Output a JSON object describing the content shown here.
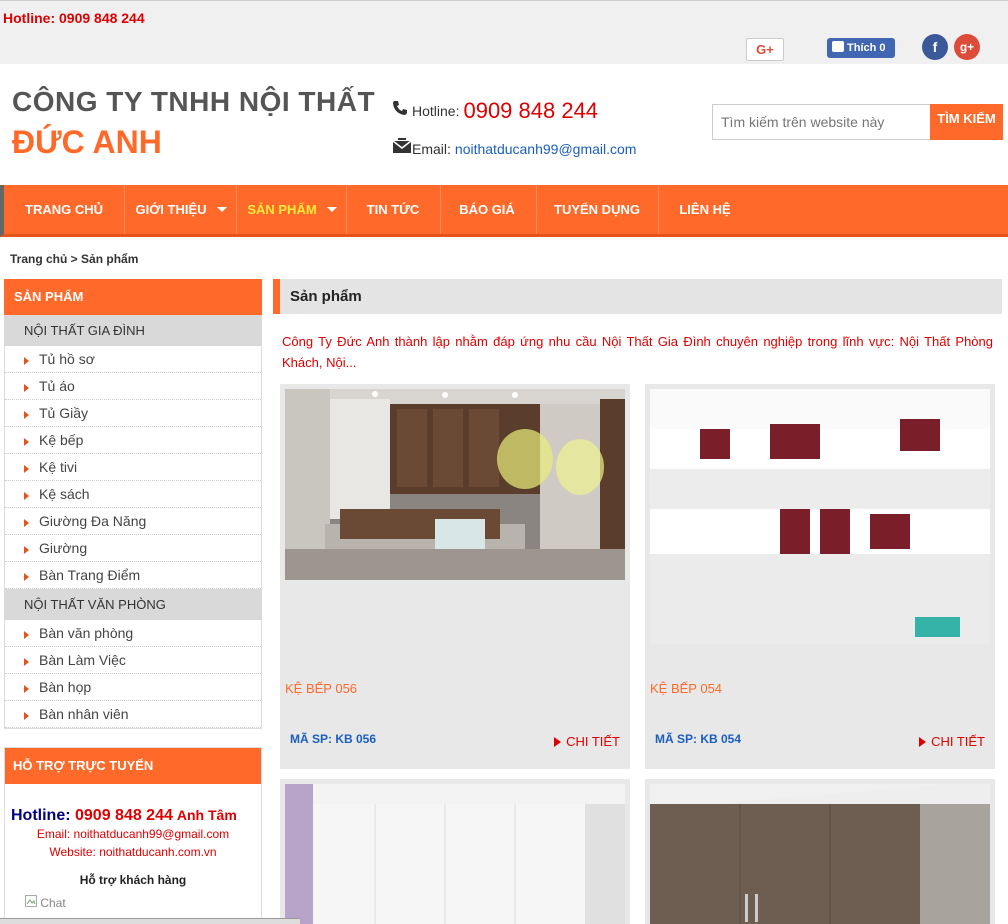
{
  "topbar": {
    "hotline": "Hotline: 0909 848 244",
    "gplus_label": "G+",
    "fb_like": "Thích 0",
    "fb_icon": "f",
    "gplus_icon": "g+"
  },
  "header": {
    "company_line1": "CÔNG TY TNHH NỘI THẤT",
    "company_line2": "ĐỨC ANH",
    "hotline_label": "Hotline:",
    "hotline_number": "0909 848 244",
    "email_label": "Email:",
    "email": "noithatducanh99@gmail.com",
    "search_placeholder": "Tìm kiếm trên website này",
    "search_button": "TÌM KIẾM"
  },
  "nav": {
    "items": [
      {
        "label": "TRANG CHỦ"
      },
      {
        "label": "GIỚI THIỆU"
      },
      {
        "label": "SẢN PHẨM"
      },
      {
        "label": "TIN TỨC"
      },
      {
        "label": "BÁO GIÁ"
      },
      {
        "label": "TUYỂN DỤNG"
      },
      {
        "label": "LIÊN HỆ"
      }
    ]
  },
  "breadcrumb": "Trang chủ  > Sản phẩm",
  "sidebar": {
    "title": "SẢN PHẨM",
    "group1": {
      "label": "NỘI THẤT GIA ĐÌNH",
      "items": [
        "Tủ hồ sơ",
        "Tủ áo",
        "Tủ Giầy",
        "Kệ bếp",
        "Kệ tivi",
        "Kệ sách",
        "Giường Đa Năng",
        "Giường",
        "Bàn Trang Điểm"
      ]
    },
    "group2": {
      "label": "NỘI THẤT VĂN PHÒNG",
      "items": [
        "Bàn văn phòng",
        "Bàn Làm Việc",
        "Bàn họp",
        "Bàn nhân viên"
      ]
    }
  },
  "support": {
    "title": "HỖ TRỢ TRỰC TUYẾN",
    "hotline_label": "Hotline: ",
    "hotline_number": "0909 848 244",
    "name": "Anh Tâm",
    "email_line": "Email: noithatducanh99@gmail.com",
    "website_line": "Website: noithatducanh.com.vn",
    "help": "Hỗ trợ khách hàng",
    "chat_alt": "Chat"
  },
  "main": {
    "title": "Sản phẩm",
    "intro": "Công Ty Đức Anh thành lập nhằm đáp ứng nhu cầu Nội Thất Gia Đình chuyên nghiệp trong lĩnh vực: Nội Thất Phòng Khách, Nội...",
    "products": [
      {
        "name": "KỆ BẾP 056",
        "code": "MÃ SP: KB 056",
        "detail": "CHI TIẾT"
      },
      {
        "name": "KỆ BẾP 054",
        "code": "MÃ SP: KB 054",
        "detail": "CHI TIẾT"
      }
    ]
  }
}
